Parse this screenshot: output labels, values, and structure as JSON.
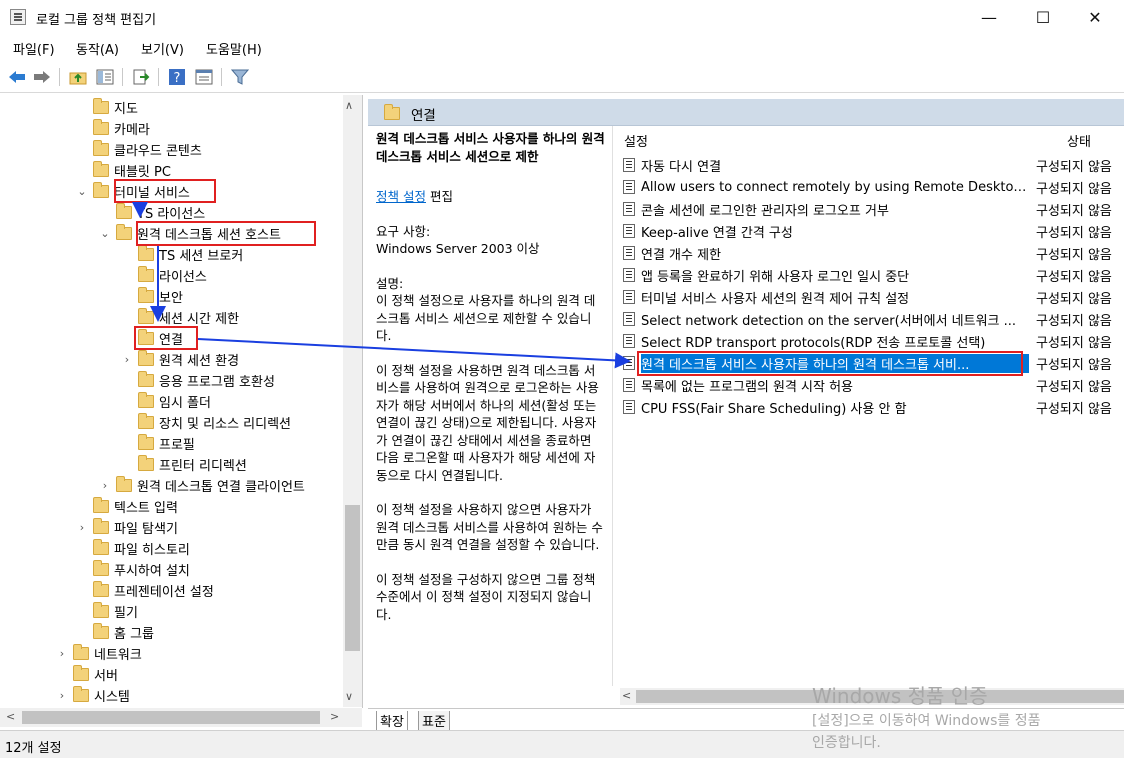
{
  "window": {
    "title": "로컬 그룹 정책 편집기",
    "minimize": "—",
    "maximize": "☐",
    "close": "✕"
  },
  "menu": [
    "파일(F)",
    "동작(A)",
    "보기(V)",
    "도움말(H)"
  ],
  "toolbar": {
    "icons": [
      "back-icon",
      "forward-icon",
      "up-folder-icon",
      "show-hide-tree-icon",
      "export-list-icon",
      "help-icon",
      "properties-icon",
      "filter-icon"
    ]
  },
  "tree": {
    "items": [
      {
        "label": "지도",
        "level": 0,
        "expander": ""
      },
      {
        "label": "카메라",
        "level": 0,
        "expander": ""
      },
      {
        "label": "클라우드 콘텐츠",
        "level": 0,
        "expander": ""
      },
      {
        "label": "태블릿 PC",
        "level": 0,
        "expander": ""
      },
      {
        "label": "터미널 서비스",
        "level": 0,
        "expander": "⌄"
      },
      {
        "label": "TS 라이선스",
        "level": 1,
        "expander": ""
      },
      {
        "label": "원격 데스크톱 세션 호스트",
        "level": 1,
        "expander": "⌄"
      },
      {
        "label": "TS 세션 브로커",
        "level": 2,
        "expander": ""
      },
      {
        "label": "라이선스",
        "level": 2,
        "expander": ""
      },
      {
        "label": "보안",
        "level": 2,
        "expander": ""
      },
      {
        "label": "세션 시간 제한",
        "level": 2,
        "expander": ""
      },
      {
        "label": "연결",
        "level": 2,
        "expander": ""
      },
      {
        "label": "원격 세션 환경",
        "level": 2,
        "expander": "›"
      },
      {
        "label": "응용 프로그램 호환성",
        "level": 2,
        "expander": ""
      },
      {
        "label": "임시 폴더",
        "level": 2,
        "expander": ""
      },
      {
        "label": "장치 및 리소스 리디렉션",
        "level": 2,
        "expander": ""
      },
      {
        "label": "프로필",
        "level": 2,
        "expander": ""
      },
      {
        "label": "프린터 리디렉션",
        "level": 2,
        "expander": ""
      },
      {
        "label": "원격 데스크톱 연결 클라이언트",
        "level": 1,
        "expander": "›"
      },
      {
        "label": "텍스트 입력",
        "level": 0,
        "expander": ""
      },
      {
        "label": "파일 탐색기",
        "level": 0,
        "expander": "›"
      },
      {
        "label": "파일 히스토리",
        "level": 0,
        "expander": ""
      },
      {
        "label": "푸시하여 설치",
        "level": 0,
        "expander": ""
      },
      {
        "label": "프레젠테이션 설정",
        "level": 0,
        "expander": ""
      },
      {
        "label": "필기",
        "level": 0,
        "expander": ""
      },
      {
        "label": "홈 그룹",
        "level": 0,
        "expander": ""
      },
      {
        "label": "네트워크",
        "level": -1,
        "expander": "›"
      },
      {
        "label": "서버",
        "level": -1,
        "expander": ""
      },
      {
        "label": "시스템",
        "level": -1,
        "expander": "›"
      }
    ]
  },
  "right": {
    "header": "연결",
    "description": {
      "title": "원격 데스크톱 서비스 사용자를 하나의 원격 데스크톱 서비스 세션으로 제한",
      "edit_link": "정책 설정",
      "edit_suffix": " 편집",
      "requirements_label": "요구 사항:",
      "requirements_value": "Windows Server 2003 이상",
      "desc_label": "설명:",
      "para1": "이 정책 설정으로 사용자를 하나의 원격 데스크톱 서비스 세션으로 제한할 수 있습니다.",
      "para2": "이 정책 설정을 사용하면 원격 데스크톱 서비스를 사용하여 원격으로 로그온하는 사용자가 해당 서버에서 하나의 세션(활성 또는 연결이 끊긴 상태)으로 제한됩니다. 사용자가 연결이 끊긴 상태에서 세션을 종료하면 다음 로그온할 때 사용자가 해당 세션에 자동으로 다시 연결됩니다.",
      "para3": "이 정책 설정을 사용하지 않으면 사용자가 원격 데스크톱 서비스를 사용하여 원하는 수만큼 동시 원격 연결을 설정할 수 있습니다.",
      "para4": "이 정책 설정을 구성하지 않으면 그룹 정책 수준에서 이 정책 설정이 지정되지 않습니다."
    },
    "columns": {
      "setting": "설정",
      "state": "상태"
    },
    "policies": [
      {
        "name": "자동 다시 연결",
        "state": "구성되지 않음"
      },
      {
        "name": "Allow users to connect remotely by using Remote Desktop...",
        "state": "구성되지 않음"
      },
      {
        "name": "콘솔 세션에 로그인한 관리자의 로그오프 거부",
        "state": "구성되지 않음"
      },
      {
        "name": "Keep-alive 연결 간격 구성",
        "state": "구성되지 않음"
      },
      {
        "name": "연결 개수 제한",
        "state": "구성되지 않음"
      },
      {
        "name": "앱 등록을 완료하기 위해 사용자 로그인 일시 중단",
        "state": "구성되지 않음"
      },
      {
        "name": "터미널 서비스 사용자 세션의 원격 제어 규칙 설정",
        "state": "구성되지 않음"
      },
      {
        "name": "Select network detection on the server(서버에서 네트워크 ...",
        "state": "구성되지 않음"
      },
      {
        "name": "Select RDP transport protocols(RDP 전송 프로토콜 선택)",
        "state": "구성되지 않음"
      },
      {
        "name": "원격 데스크톱 서비스 사용자를 하나의 원격 데스크톱 서비...",
        "state": "구성되지 않음",
        "selected": true
      },
      {
        "name": "목록에 없는 프로그램의 원격 시작 허용",
        "state": "구성되지 않음"
      },
      {
        "name": "CPU FSS(Fair Share Scheduling) 사용 안 함",
        "state": "구성되지 않음"
      }
    ],
    "tabs": [
      "확장",
      "표준"
    ]
  },
  "status": {
    "text": "12개 설정"
  },
  "watermark": {
    "line1": "Windows 정품 인증",
    "line2": "[설정]으로 이동하여 Windows를 정품",
    "line3": "인증합니다."
  },
  "colors": {
    "selection": "#0078d7",
    "annotation_red": "#e02020",
    "annotation_blue": "#1a3fe0",
    "pane_header": "#cfdbe8"
  }
}
